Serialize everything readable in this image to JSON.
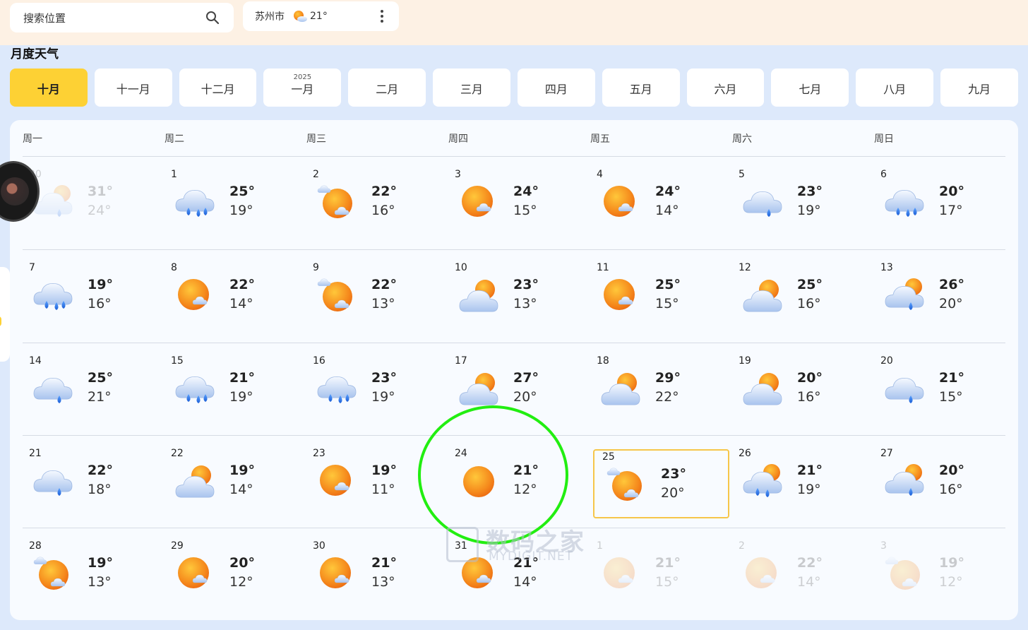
{
  "search": {
    "placeholder": "搜索位置",
    "icon": "search-icon"
  },
  "location": {
    "city": "苏州市",
    "temp": "21°",
    "icon": "partly-cloudy-icon"
  },
  "section_title": "月度天气",
  "months": [
    {
      "label": "十月",
      "year": "",
      "active": true
    },
    {
      "label": "十一月",
      "year": ""
    },
    {
      "label": "十二月",
      "year": ""
    },
    {
      "label": "一月",
      "year": "2025"
    },
    {
      "label": "二月",
      "year": ""
    },
    {
      "label": "三月",
      "year": ""
    },
    {
      "label": "四月",
      "year": ""
    },
    {
      "label": "五月",
      "year": ""
    },
    {
      "label": "六月",
      "year": ""
    },
    {
      "label": "七月",
      "year": ""
    },
    {
      "label": "八月",
      "year": ""
    },
    {
      "label": "九月",
      "year": ""
    }
  ],
  "weekdays": [
    "周一",
    "周二",
    "周三",
    "周四",
    "周五",
    "周六",
    "周日"
  ],
  "weeks": [
    [
      {
        "day": "30",
        "icon": "sun-cloud-rain-icon",
        "hi": "31°",
        "lo": "24°",
        "faded": true
      },
      {
        "day": "1",
        "icon": "heavy-rain-icon",
        "hi": "25°",
        "lo": "19°"
      },
      {
        "day": "2",
        "icon": "cloud-sun-cloud-icon",
        "hi": "22°",
        "lo": "16°"
      },
      {
        "day": "3",
        "icon": "sun-small-cloud-icon",
        "hi": "24°",
        "lo": "15°"
      },
      {
        "day": "4",
        "icon": "sun-small-cloud-icon",
        "hi": "24°",
        "lo": "14°"
      },
      {
        "day": "5",
        "icon": "cloud-rain-icon",
        "hi": "23°",
        "lo": "19°"
      },
      {
        "day": "6",
        "icon": "heavy-rain-icon",
        "hi": "20°",
        "lo": "17°"
      }
    ],
    [
      {
        "day": "7",
        "icon": "heavy-rain-icon",
        "hi": "19°",
        "lo": "16°"
      },
      {
        "day": "8",
        "icon": "sun-small-cloud-icon",
        "hi": "22°",
        "lo": "14°"
      },
      {
        "day": "9",
        "icon": "cloud-sun-cloud-icon",
        "hi": "22°",
        "lo": "13°"
      },
      {
        "day": "10",
        "icon": "cloudy-sun-icon",
        "hi": "23°",
        "lo": "13°"
      },
      {
        "day": "11",
        "icon": "sun-small-cloud-icon",
        "hi": "25°",
        "lo": "15°"
      },
      {
        "day": "12",
        "icon": "cloudy-sun-icon",
        "hi": "25°",
        "lo": "16°"
      },
      {
        "day": "13",
        "icon": "sun-cloud-rain-icon",
        "hi": "26°",
        "lo": "20°"
      }
    ],
    [
      {
        "day": "14",
        "icon": "cloud-rain-icon",
        "hi": "25°",
        "lo": "21°"
      },
      {
        "day": "15",
        "icon": "heavy-rain-icon",
        "hi": "21°",
        "lo": "19°"
      },
      {
        "day": "16",
        "icon": "heavy-rain-icon",
        "hi": "23°",
        "lo": "19°"
      },
      {
        "day": "17",
        "icon": "cloudy-sun-icon",
        "hi": "27°",
        "lo": "20°"
      },
      {
        "day": "18",
        "icon": "cloudy-sun-icon",
        "hi": "29°",
        "lo": "22°"
      },
      {
        "day": "19",
        "icon": "cloudy-sun-icon",
        "hi": "20°",
        "lo": "16°"
      },
      {
        "day": "20",
        "icon": "cloud-rain-icon",
        "hi": "21°",
        "lo": "15°"
      }
    ],
    [
      {
        "day": "21",
        "icon": "cloud-rain-icon",
        "hi": "22°",
        "lo": "18°"
      },
      {
        "day": "22",
        "icon": "cloudy-sun-icon",
        "hi": "19°",
        "lo": "14°"
      },
      {
        "day": "23",
        "icon": "sun-small-cloud-icon",
        "hi": "19°",
        "lo": "11°"
      },
      {
        "day": "24",
        "icon": "sunny-icon",
        "hi": "21°",
        "lo": "12°"
      },
      {
        "day": "25",
        "icon": "cloud-sun-cloud-icon",
        "hi": "23°",
        "lo": "20°",
        "selected": true
      },
      {
        "day": "26",
        "icon": "sun-heavy-rain-icon",
        "hi": "21°",
        "lo": "19°"
      },
      {
        "day": "27",
        "icon": "sun-cloud-rain-icon",
        "hi": "20°",
        "lo": "16°"
      }
    ],
    [
      {
        "day": "28",
        "icon": "cloud-sun-cloud-icon",
        "hi": "19°",
        "lo": "13°"
      },
      {
        "day": "29",
        "icon": "sun-small-cloud-icon",
        "hi": "20°",
        "lo": "12°"
      },
      {
        "day": "30",
        "icon": "sun-small-cloud-icon",
        "hi": "21°",
        "lo": "13°"
      },
      {
        "day": "31",
        "icon": "sun-small-cloud-icon",
        "hi": "21°",
        "lo": "14°"
      },
      {
        "day": "1",
        "icon": "sun-small-cloud-icon",
        "hi": "21°",
        "lo": "15°",
        "faded": true
      },
      {
        "day": "2",
        "icon": "sun-small-cloud-icon",
        "hi": "22°",
        "lo": "14°",
        "faded": true
      },
      {
        "day": "3",
        "icon": "cloud-sun-cloud-icon",
        "hi": "19°",
        "lo": "12°",
        "faded": true
      }
    ]
  ],
  "watermark": {
    "line1": "数码之家",
    "line2": "MYDIGIT.NET"
  },
  "colors": {
    "active_month": "#fdd134",
    "selected_border": "#f6c64a",
    "annotation": "#22ee11",
    "sun": "#f28a1d",
    "cloud": "#b7cdef",
    "rain": "#2f77e8"
  }
}
